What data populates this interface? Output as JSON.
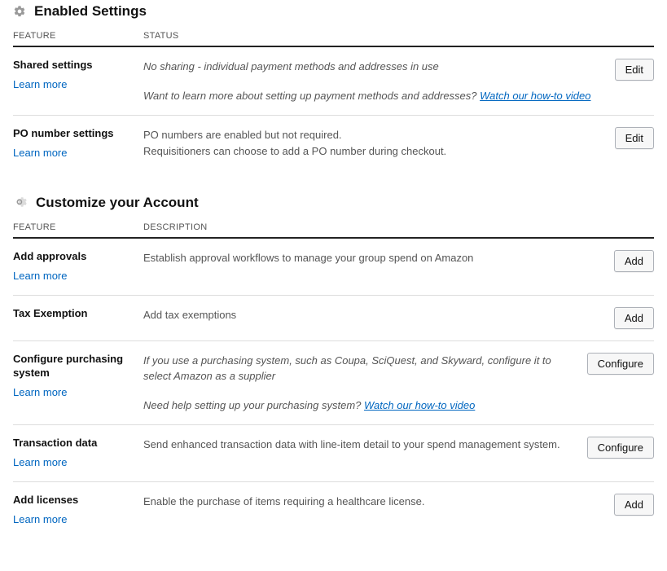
{
  "sections": [
    {
      "title": "Enabled Settings",
      "col1": "FEATURE",
      "col2": "STATUS"
    },
    {
      "title": "Customize your Account",
      "col1": "FEATURE",
      "col2": "DESCRIPTION"
    }
  ],
  "learn_more_label": "Learn more",
  "enabled": {
    "shared_settings": {
      "name": "Shared settings",
      "status": "No sharing - individual payment methods and addresses in use",
      "prompt": "Want to learn more about setting up payment methods and addresses? ",
      "link": "Watch our how-to video",
      "action": "Edit"
    },
    "po_number": {
      "name": "PO number settings",
      "line1": "PO numbers are enabled but not required.",
      "line2": "Requisitioners can choose to add a PO number during checkout.",
      "action": "Edit"
    }
  },
  "customize": {
    "approvals": {
      "name": "Add approvals",
      "desc": "Establish approval workflows to manage your group spend on Amazon",
      "action": "Add"
    },
    "tax": {
      "name": "Tax Exemption",
      "desc": "Add tax exemptions",
      "action": "Add"
    },
    "purchasing": {
      "name": "Configure purchasing system",
      "desc": "If you use a purchasing system, such as Coupa, SciQuest, and Skyward, configure it to select Amazon as a supplier",
      "prompt": "Need help setting up your purchasing system? ",
      "link": "Watch our how-to video",
      "action": "Configure"
    },
    "transaction": {
      "name": "Transaction data",
      "desc": "Send enhanced transaction data with line-item detail to your spend management system.",
      "action": "Configure"
    },
    "licenses": {
      "name": "Add licenses",
      "desc": "Enable the purchase of items requiring a healthcare license.",
      "action": "Add"
    }
  }
}
